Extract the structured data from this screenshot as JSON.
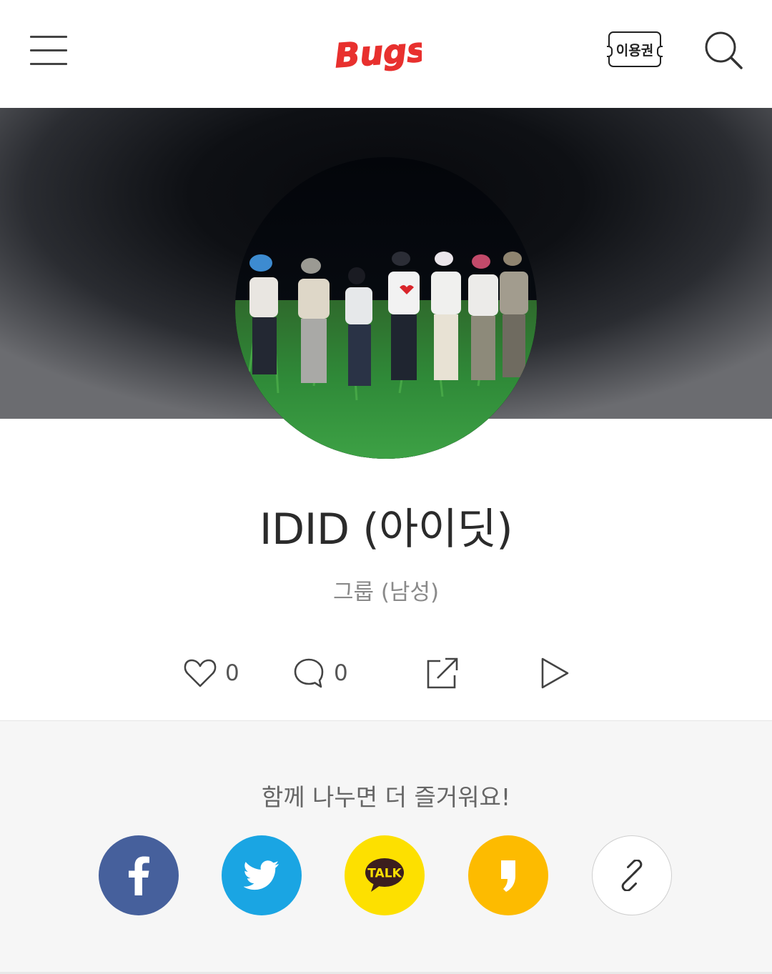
{
  "header": {
    "logo_text": "Bugs!",
    "ticket_label": "이용권",
    "menu_icon": "hamburger-menu-icon",
    "search_icon": "search-icon"
  },
  "artist": {
    "name": "IDID (아이딧)",
    "type": "그룹 (남성)"
  },
  "actions": {
    "like_count": "0",
    "comment_count": "0"
  },
  "share": {
    "title": "함께 나누면 더 즐거워요!",
    "kakaotalk_label": "TALK",
    "buttons": [
      "facebook",
      "twitter",
      "kakaotalk",
      "kakaostory",
      "link"
    ]
  },
  "colors": {
    "brand_red": "#e8302e",
    "facebook": "#46609c",
    "twitter": "#1aa5e3",
    "kakaotalk": "#fde000",
    "kakaostory": "#fdbb00"
  }
}
